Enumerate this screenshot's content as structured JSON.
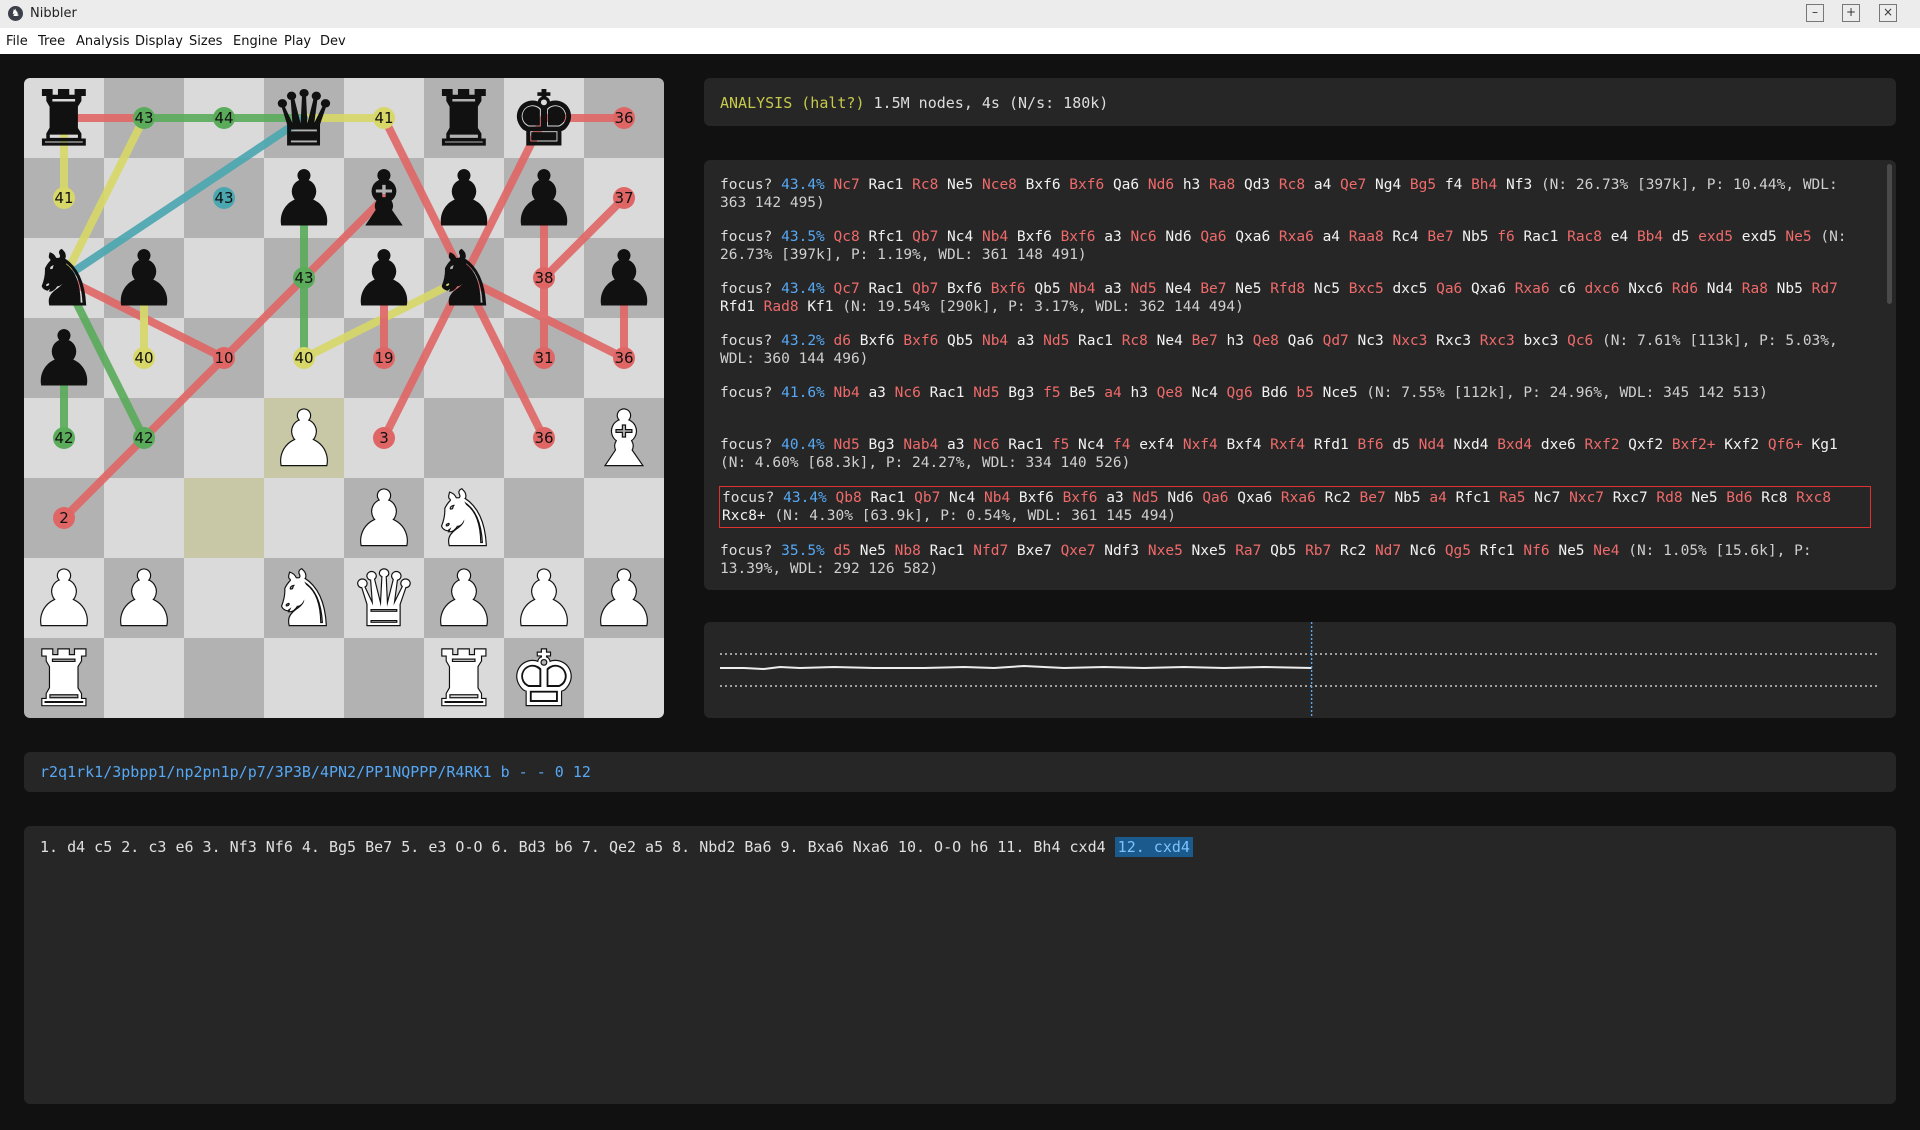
{
  "window": {
    "title": "Nibbler",
    "app_icon": "nibbler-logo-icon"
  },
  "menu": [
    "File",
    "Tree",
    "Analysis",
    "Display",
    "Sizes",
    "Engine",
    "Play",
    "Dev"
  ],
  "colors": {
    "white_move": "#f2f2f2",
    "black_move": "#ef6a6a",
    "score": "#56a8f5",
    "status_head": "#c7c94a",
    "light_square": "#dadada",
    "dark_square": "#b2b2b2",
    "last_move_square": "#c8c8a6",
    "arrow_green": "#5aab5a",
    "arrow_yellow": "#d8d868",
    "arrow_red": "#e06666",
    "arrow_teal": "#4aa7b0"
  },
  "status": {
    "head": "ANALYSIS (halt?)",
    "info": "1.5M nodes, 4s (N/s: 180k)"
  },
  "board": {
    "fen": "r2q1rk1/3pbpp1/np2pn1p/p7/3P3B/4PN2/PP1NQPPP/R4RK1 b - - 0 12",
    "last_move": [
      "c3",
      "d4"
    ],
    "labels": [
      {
        "sq": "b8",
        "v": "43",
        "c": "g"
      },
      {
        "sq": "c8",
        "v": "44",
        "c": "g"
      },
      {
        "sq": "e8",
        "v": "41",
        "c": "y"
      },
      {
        "sq": "h8",
        "v": "36",
        "c": "r"
      },
      {
        "sq": "a7",
        "v": "41",
        "c": "y"
      },
      {
        "sq": "c7",
        "v": "43",
        "c": "t"
      },
      {
        "sq": "h7",
        "v": "37",
        "c": "r"
      },
      {
        "sq": "d6",
        "v": "43",
        "c": "g"
      },
      {
        "sq": "g6",
        "v": "38",
        "c": "r"
      },
      {
        "sq": "b5",
        "v": "40",
        "c": "y"
      },
      {
        "sq": "c5",
        "v": "10",
        "c": "r"
      },
      {
        "sq": "d5",
        "v": "40",
        "c": "y"
      },
      {
        "sq": "e5",
        "v": "19",
        "c": "r"
      },
      {
        "sq": "g5",
        "v": "31",
        "c": "r"
      },
      {
        "sq": "h5",
        "v": "36",
        "c": "r"
      },
      {
        "sq": "a4",
        "v": "42",
        "c": "g"
      },
      {
        "sq": "b4",
        "v": "42",
        "c": "g"
      },
      {
        "sq": "e4",
        "v": "3",
        "c": "r"
      },
      {
        "sq": "g4",
        "v": "36",
        "c": "r"
      },
      {
        "sq": "a3",
        "v": "2",
        "c": "r"
      }
    ],
    "arrows": [
      {
        "from": "a8",
        "to": "d8",
        "c": "r"
      },
      {
        "from": "a8",
        "to": "a7",
        "c": "y"
      },
      {
        "from": "d8",
        "to": "b8",
        "c": "g"
      },
      {
        "from": "d8",
        "to": "e8",
        "c": "y"
      },
      {
        "from": "d8",
        "to": "a6",
        "c": "t"
      },
      {
        "from": "a6",
        "to": "b8",
        "c": "y"
      },
      {
        "from": "a6",
        "to": "c5",
        "c": "r"
      },
      {
        "from": "a6",
        "to": "b4",
        "c": "g"
      },
      {
        "from": "a5",
        "to": "a4",
        "c": "g"
      },
      {
        "from": "b6",
        "to": "b5",
        "c": "y"
      },
      {
        "from": "d7",
        "to": "d6",
        "c": "g"
      },
      {
        "from": "d7",
        "to": "d5",
        "c": "g"
      },
      {
        "from": "e7",
        "to": "a3",
        "c": "r"
      },
      {
        "from": "f6",
        "to": "d5",
        "c": "y"
      },
      {
        "from": "f6",
        "to": "e4",
        "c": "r"
      },
      {
        "from": "f6",
        "to": "g4",
        "c": "r"
      },
      {
        "from": "f6",
        "to": "h5",
        "c": "r"
      },
      {
        "from": "f6",
        "to": "e8",
        "c": "r"
      },
      {
        "from": "g8",
        "to": "h8",
        "c": "r"
      },
      {
        "from": "g8",
        "to": "f6",
        "c": "r"
      },
      {
        "from": "g7",
        "to": "g5",
        "c": "r"
      },
      {
        "from": "h6",
        "to": "h5",
        "c": "r"
      },
      {
        "from": "g6",
        "to": "h7",
        "c": "r"
      },
      {
        "from": "e6",
        "to": "e5",
        "c": "r"
      }
    ]
  },
  "lines": [
    {
      "score": "43.4%",
      "moves": [
        "Nc7",
        "Rac1",
        "Rc8",
        "Ne5",
        "Nce8",
        "Bxf6",
        "Bxf6",
        "Qa6",
        "Nd6",
        "h3",
        "Ra8",
        "Qd3",
        "Rc8",
        "a4",
        "Qe7",
        "Ng4",
        "Bg5",
        "f4",
        "Bh4",
        "Nf3"
      ],
      "stats": "(N: 26.73% [397k], P: 10.44%, WDL: 363 142 495)"
    },
    {
      "score": "43.5%",
      "moves": [
        "Qc8",
        "Rfc1",
        "Qb7",
        "Nc4",
        "Nb4",
        "Bxf6",
        "Bxf6",
        "a3",
        "Nc6",
        "Nd6",
        "Qa6",
        "Qxa6",
        "Rxa6",
        "a4",
        "Raa8",
        "Rc4",
        "Be7",
        "Nb5",
        "f6",
        "Rac1",
        "Rac8",
        "e4",
        "Bb4",
        "d5",
        "exd5",
        "exd5",
        "Ne5"
      ],
      "stats": "(N: 26.73% [397k], P: 1.19%, WDL: 361 148 491)"
    },
    {
      "score": "43.4%",
      "moves": [
        "Qc7",
        "Rac1",
        "Qb7",
        "Bxf6",
        "Bxf6",
        "Qb5",
        "Nb4",
        "a3",
        "Nd5",
        "Ne4",
        "Be7",
        "Ne5",
        "Rfd8",
        "Nc5",
        "Bxc5",
        "dxc5",
        "Qa6",
        "Qxa6",
        "Rxa6",
        "c6",
        "dxc6",
        "Nxc6",
        "Rd6",
        "Nd4",
        "Ra8",
        "Nb5",
        "Rd7",
        "Rfd1",
        "Rad8",
        "Kf1"
      ],
      "stats": "(N: 19.54% [290k], P: 3.17%, WDL: 362 144 494)"
    },
    {
      "score": "43.2%",
      "moves": [
        "d6",
        "Bxf6",
        "Bxf6",
        "Qb5",
        "Nb4",
        "a3",
        "Nd5",
        "Rac1",
        "Rc8",
        "Ne4",
        "Be7",
        "h3",
        "Qe8",
        "Qa6",
        "Qd7",
        "Nc3",
        "Nxc3",
        "Rxc3",
        "Rxc3",
        "bxc3",
        "Qc6"
      ],
      "stats": "(N: 7.61% [113k], P: 5.03%, WDL: 360 144 496)"
    },
    {
      "score": "41.6%",
      "moves": [
        "Nb4",
        "a3",
        "Nc6",
        "Rac1",
        "Nd5",
        "Bg3",
        "f5",
        "Be5",
        "a4",
        "h3",
        "Qe8",
        "Nc4",
        "Qg6",
        "Bd6",
        "b5",
        "Nce5"
      ],
      "stats": "(N: 7.55% [112k], P: 24.96%, WDL: 345 142 513)"
    },
    {
      "score": "40.4%",
      "moves": [
        "Nd5",
        "Bg3",
        "Nab4",
        "a3",
        "Nc6",
        "Rac1",
        "f5",
        "Nc4",
        "f4",
        "exf4",
        "Nxf4",
        "Bxf4",
        "Rxf4",
        "Rfd1",
        "Bf6",
        "d5",
        "Nd4",
        "Nxd4",
        "Bxd4",
        "dxe6",
        "Rxf2",
        "Qxf2",
        "Bxf2+",
        "Kxf2",
        "Qf6+",
        "Kg1"
      ],
      "stats": "(N: 4.60% [68.3k], P: 24.27%, WDL: 334 140 526)"
    },
    {
      "score": "43.4%",
      "moves": [
        "Qb8",
        "Rac1",
        "Qb7",
        "Nc4",
        "Nb4",
        "Bxf6",
        "Bxf6",
        "a3",
        "Nd5",
        "Nd6",
        "Qa6",
        "Qxa6",
        "Rxa6",
        "Rc2",
        "Be7",
        "Nb5",
        "a4",
        "Rfc1",
        "Ra5",
        "Nc7",
        "Nxc7",
        "Rxc7",
        "Rd8",
        "Ne5",
        "Bd6",
        "Rc8",
        "Rxc8",
        "Rxc8+"
      ],
      "stats": "(N: 4.30% [63.9k], P: 0.54%, WDL: 361 145 494)",
      "selected": true
    },
    {
      "score": "35.5%",
      "moves": [
        "d5",
        "Ne5",
        "Nb8",
        "Rac1",
        "Nfd7",
        "Bxe7",
        "Qxe7",
        "Ndf3",
        "Nxe5",
        "Nxe5",
        "Ra7",
        "Qb5",
        "Rb7",
        "Rc2",
        "Nd7",
        "Nc6",
        "Qg5",
        "Rfc1",
        "Nf6",
        "Ne5",
        "Ne4"
      ],
      "stats": "(N: 1.05% [15.6k], P: 13.39%, WDL: 292 126 582)"
    }
  ],
  "focus_label": "focus?",
  "graph": {
    "current_index_fraction": 0.51
  },
  "fen": "r2q1rk1/3pbpp1/np2pn1p/p7/3P3B/4PN2/PP1NQPPP/R4RK1 b - - 0 12",
  "movelist": {
    "text": "1. d4 c5 2. c3 e6 3. Nf3 Nf6 4. Bg5 Be7 5. e3 O-O 6. Bd3 b6 7. Qe2 a5 8. Nbd2 Ba6 9. Bxa6 Nxa6 10. O-O h6 11. Bh4 cxd4",
    "current": "12. cxd4"
  }
}
